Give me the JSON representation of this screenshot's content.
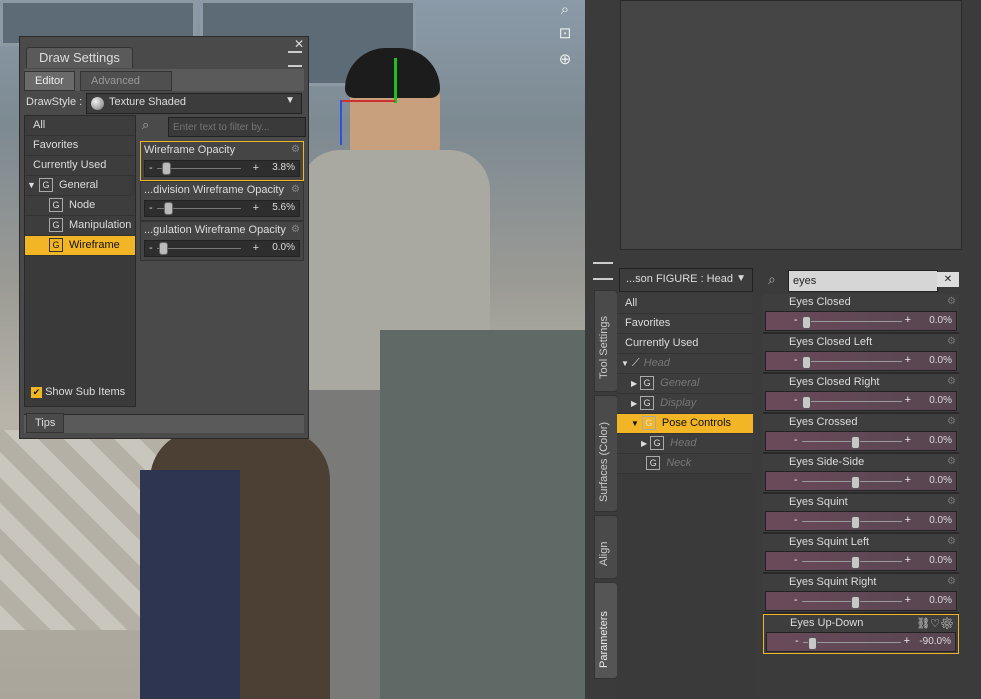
{
  "viewport": {
    "icons": [
      "search-icon",
      "frame-icon",
      "orbit-icon"
    ]
  },
  "draw_settings": {
    "title": "Draw Settings",
    "tabs": [
      "Editor",
      "Advanced"
    ],
    "drawstyle_label": "DrawStyle :",
    "drawstyle_value": "Texture Shaded",
    "filter_placeholder": "Enter text to filter by...",
    "categories": [
      "All",
      "Favorites",
      "Currently Used"
    ],
    "tree": {
      "group": "General",
      "children": [
        "Node Highli...",
        "Manipulation",
        "Wireframe"
      ],
      "selected": "Wireframe"
    },
    "params": [
      {
        "label": "Wireframe Opacity",
        "value": "3.8%",
        "level": 0.038
      },
      {
        "label": "...division Wireframe Opacity",
        "value": "5.6%",
        "level": 0.056
      },
      {
        "label": "...gulation Wireframe Opacity",
        "value": "0.0%",
        "level": 0.0
      }
    ],
    "show_sub_items": "Show Sub Items",
    "tips": "Tips"
  },
  "params_pane": {
    "scope": "...son FIGURE : Head",
    "search_value": "eyes",
    "vertical_tabs": [
      "Tool Settings",
      "Surfaces (Color)",
      "Align",
      "Parameters"
    ],
    "categories": [
      "All",
      "Favorites",
      "Currently Used"
    ],
    "tree": [
      {
        "label": "Head",
        "dim": true,
        "level": 0
      },
      {
        "label": "General",
        "dim": true,
        "level": 1
      },
      {
        "label": "Display",
        "dim": true,
        "level": 1
      },
      {
        "label": "Pose Controls",
        "dim": false,
        "level": 1,
        "selected": true
      },
      {
        "label": "Head",
        "dim": true,
        "level": 2
      },
      {
        "label": "Neck",
        "dim": true,
        "level": 2
      }
    ],
    "morphs": [
      {
        "label": "Eyes Closed",
        "value": "0.0%",
        "level": 0.0
      },
      {
        "label": "Eyes Closed Left",
        "value": "0.0%",
        "level": 0.0
      },
      {
        "label": "Eyes Closed Right",
        "value": "0.0%",
        "level": 0.0
      },
      {
        "label": "Eyes Crossed",
        "value": "0.0%",
        "level": 0.5
      },
      {
        "label": "Eyes Side-Side",
        "value": "0.0%",
        "level": 0.5
      },
      {
        "label": "Eyes Squint",
        "value": "0.0%",
        "level": 0.5
      },
      {
        "label": "Eyes Squint Left",
        "value": "0.0%",
        "level": 0.5
      },
      {
        "label": "Eyes Squint Right",
        "value": "0.0%",
        "level": 0.5
      },
      {
        "label": "Eyes Up-Down",
        "value": "-90.0%",
        "level": 0.05,
        "selected": true
      }
    ]
  },
  "colors": {
    "accent": "#f2b526"
  }
}
